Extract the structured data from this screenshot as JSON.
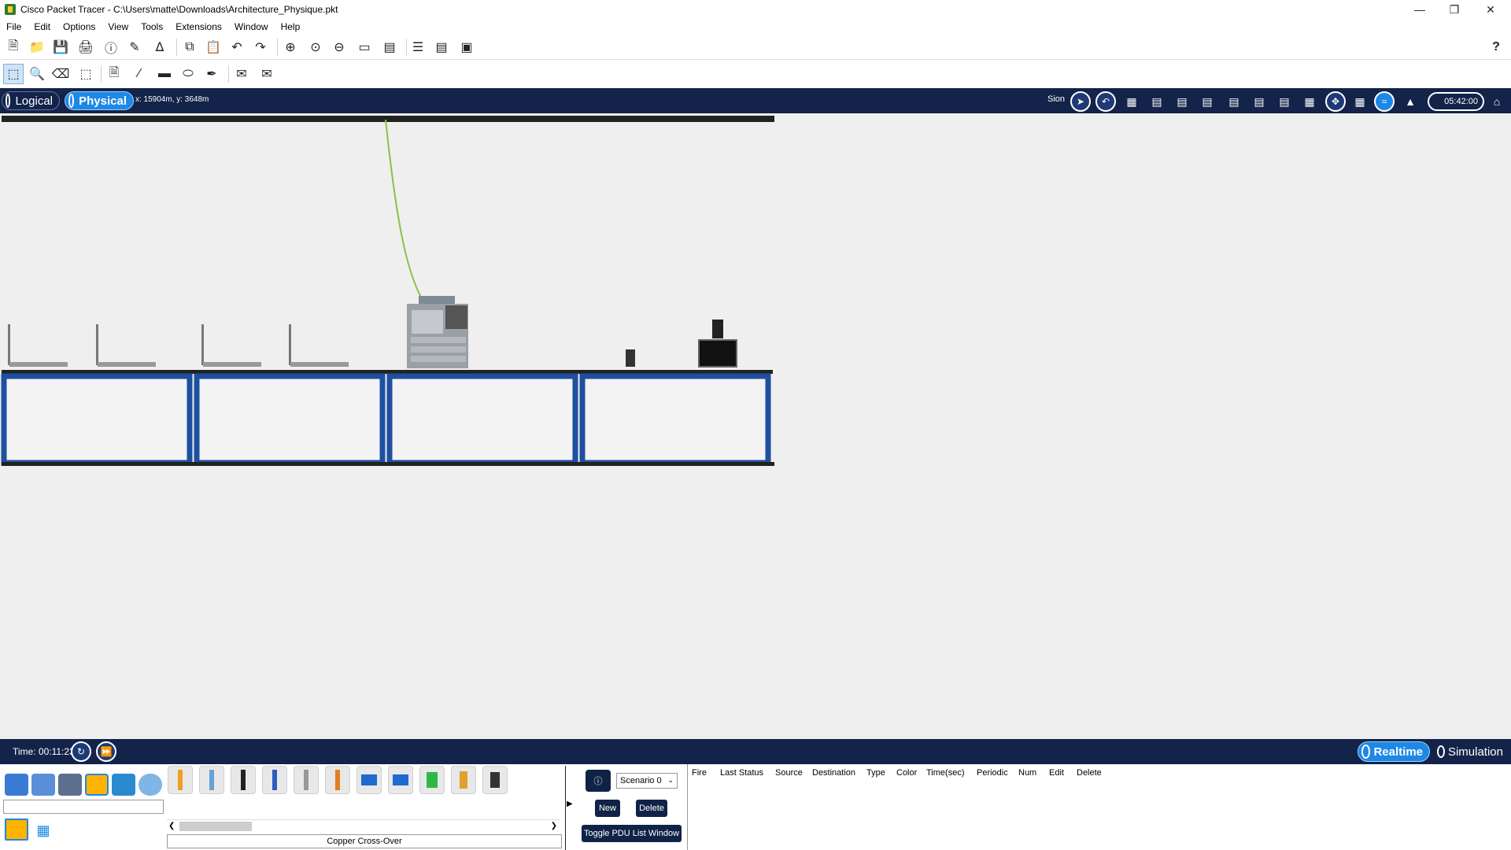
{
  "window": {
    "title": "Cisco Packet Tracer - C:\\Users\\matte\\Downloads\\Architecture_Physique.pkt"
  },
  "menu": [
    "File",
    "Edit",
    "Options",
    "View",
    "Tools",
    "Extensions",
    "Window",
    "Help"
  ],
  "help_glyph": "?",
  "modebar": {
    "logical_label": "Logical",
    "physical_label": "Physical",
    "coordinates": "x: 15904m, y: 3648m",
    "sion_label": "Sion",
    "clock": "05:42:00"
  },
  "bottombar": {
    "time": "Time: 00:11:23",
    "realtime_label": "Realtime",
    "simulation_label": "Simulation"
  },
  "device_panel": {
    "search_value": "",
    "selected_cable": "Copper Cross-Over"
  },
  "pdu": {
    "scenario": "Scenario 0",
    "new_label": "New",
    "delete_label": "Delete",
    "toggle_label": "Toggle PDU List Window",
    "columns": [
      "Fire",
      "Last Status",
      "Source",
      "Destination",
      "Type",
      "Color",
      "Time(sec)",
      "Periodic",
      "Num",
      "Edit",
      "Delete"
    ]
  },
  "colors": {
    "nav": "#13234a",
    "accent": "#1e88e5",
    "table_frame": "#1e4fa0",
    "cable_green": "#8bc34a"
  }
}
